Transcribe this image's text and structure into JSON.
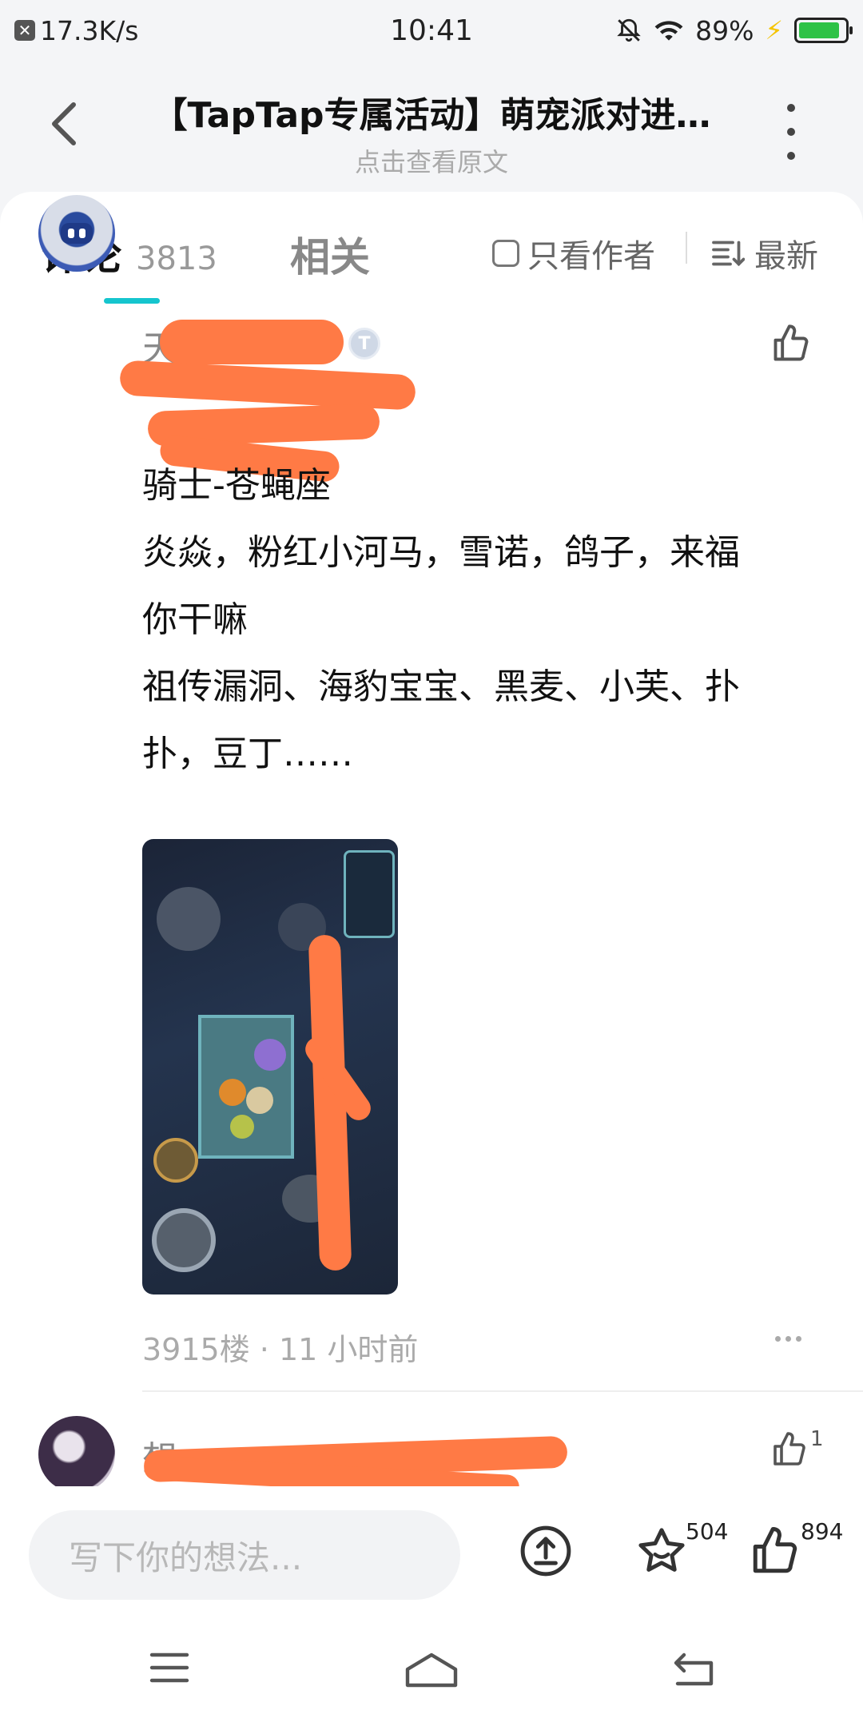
{
  "status_bar": {
    "net_speed": "17.3K/s",
    "time": "10:41",
    "battery_pct": "89%",
    "battery_level": 0.89,
    "colors": {
      "battery": "#2ec246",
      "bolt": "#f5c400"
    }
  },
  "header": {
    "title": "【TapTap专属活动】萌宠派对进…",
    "subtitle": "点击查看原文"
  },
  "tabs": {
    "comments_label": "评论",
    "comments_count": "3813",
    "related_label": "相关",
    "author_only_label": "只看作者",
    "sort_label": "最新",
    "accent": "#15c5ce"
  },
  "comment": {
    "username_partial": "天",
    "badge": "T",
    "lines": [
      "骑士-苍蝇座",
      "炎焱，粉红小河马，雪诺，鸽子，来福",
      "你干嘛",
      "祖传漏洞、海豹宝宝、黑麦、小芙、扑",
      "扑，豆丁……"
    ],
    "floor_and_time": "3915楼 · 11 小时前"
  },
  "comment2": {
    "username_partial": "想",
    "like_count": "1"
  },
  "bottom_bar": {
    "input_placeholder": "写下你的想法...",
    "favorite_count": "504",
    "like_count": "894"
  },
  "redaction_color": "#ff7a45"
}
